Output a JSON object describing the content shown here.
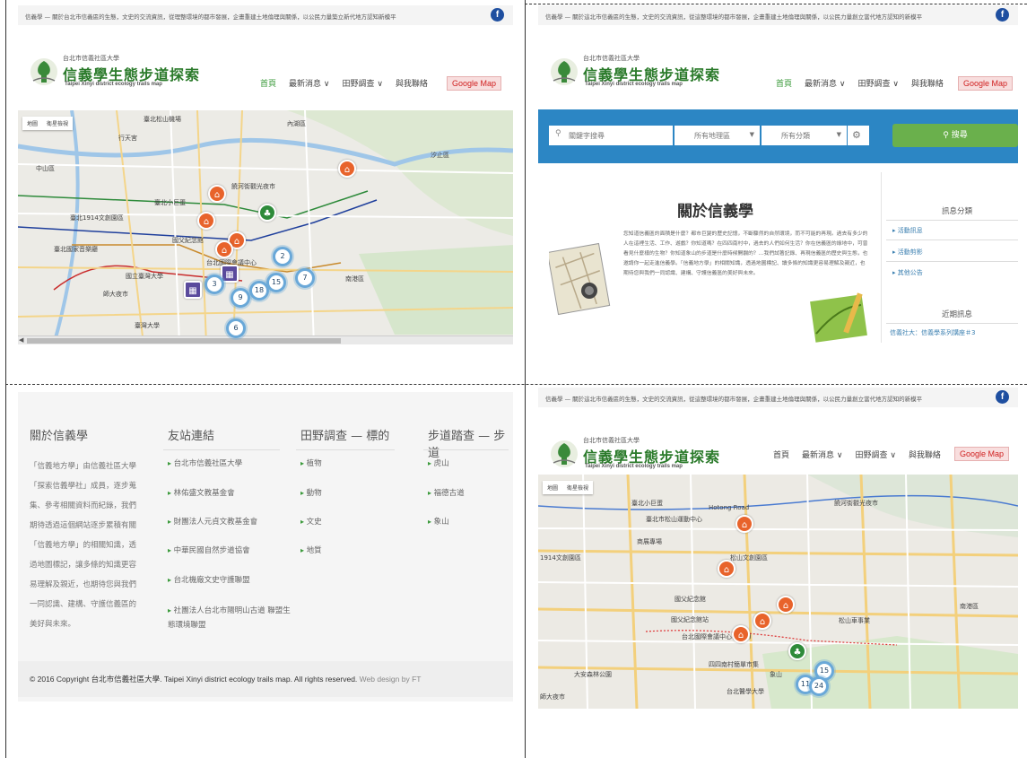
{
  "notice": "信義學 — 關於台北市信義區的生態，文史的交流資訊，從理整環境的都市發展，企畫重建土地倫理與關係，以公民力量築立新代地方認知新模平",
  "notice_q2": "信義學 — 關於這北市信義區的生態，文史的交流資訊，從這整環境的都市發展，企畫重建土地倫理與關係，以公民力量創立當代地方認知的新模平",
  "facebook_icon": "f",
  "site": {
    "subtitle": "台北市信義社區大學",
    "title": "信義學生態步道探索",
    "english": "Taipei Xinyi district ecology trails map"
  },
  "nav": {
    "home": "首頁",
    "news": "最新消息 ∨",
    "field": "田野調查 ∨",
    "contact": "與我聯絡",
    "google_map": "Google Map"
  },
  "map": {
    "tab_map": "地圖",
    "tab_satellite": "衛星檢視",
    "labels_q1": [
      "臺北松山機場",
      "內湖區",
      "行天宮",
      "饒河街觀光夜市",
      "臺北小巨蛋",
      "臺北1914文創園區",
      "國父紀念館",
      "臺北國家音樂廳",
      "台北國際會議中心",
      "國立臺灣大學",
      "臺灣大學",
      "師大夜市",
      "南港區",
      "汐止區",
      "中山區"
    ],
    "labels_q4": [
      "臺北小巨蛋",
      "臺北市松山運動中心",
      "饒河街觀光夜市",
      "Hotong Road",
      "商展專場",
      "1914文創園區",
      "松山文創園區",
      "國父紀念館",
      "國父紀念館站",
      "台北國際會議中心(TICC)",
      "四四南村簡單市集",
      "大安森林公園",
      "象山",
      "台北醫學大學",
      "師大夜市",
      "松山車事業",
      "南港區"
    ],
    "clusters_q1": [
      "2",
      "3",
      "9",
      "15",
      "7",
      "6",
      "18"
    ],
    "clusters_q4": [
      "15",
      "11",
      "24"
    ]
  },
  "search": {
    "keyword_placeholder": "關鍵字搜尋",
    "area": "所有地理區",
    "category": "所有分類",
    "button": "搜尋"
  },
  "about": {
    "title": "關於信義學",
    "body": "您知道信義區的面積是什麼？都市巨變的歷史記憶，不斷驟然的自然環境，而不可能的再現。過去有多少的人在這裡生活、工作、遊戲？你知道嗎？在四四南村中，過去的人們如何生活？你在信義區的綠地中，可曾看見什麼樣的生物？你知道象山的步道是什麼時候開闢的？…我們試著記錄、再現信義區的歷史與生態，也邀請你一起走進信義學。「信義地方學」的相關知識，透過地圖標記、讀多條的知識更容易理解及親近，也期待您與我們一同認識、建構、守護信義區的美好與未來。"
  },
  "sidebar": {
    "categories_title": "訊息分類",
    "items": [
      "活動訊息",
      "活動剪影",
      "其他公告"
    ],
    "recent_title": "近期訊息",
    "recent_item": "信義社大：信義學系列講座＃3"
  },
  "footer": {
    "about_title": "關於信義學",
    "about_text": "「信義地方學」由信義社區大學「探索信義學社」成員，逐步蒐集、參考相關資料而紀錄，我們期待透過這個網站逐步累積有關「信義地方學」的相關知識，透過地圖標記，讓多條的知識更容易理解及親近，也期待您與我們一同認識、建構、守護信義區的美好與未來。",
    "links_title": "友站連結",
    "links": [
      "台北市信義社區大學",
      "林佑盛文教基金會",
      "財團法人元貞文教基金會",
      "中華民國自然步道協會",
      "台北機廠文史守護聯盟",
      "社團法人台北市陽明山古道 聯盟生態環境聯盟"
    ],
    "field_title": "田野調查 — 標的",
    "field_items": [
      "植物",
      "動物",
      "文史",
      "地質"
    ],
    "trail_title": "步道踏查 — 步道",
    "trail_items": [
      "虎山",
      "福德古道",
      "象山"
    ],
    "copyright": "© 2016 Copyright 台北市信義社區大學. Taipei Xinyi district ecology trails map. All rights reserved.",
    "credit": "Web design by FT"
  },
  "colors": {
    "accent": "#2a7a2a",
    "search_bar": "#2c86c4",
    "search_button": "#6ab04c",
    "marker": "#e8632b",
    "google_map": "#d02020"
  }
}
